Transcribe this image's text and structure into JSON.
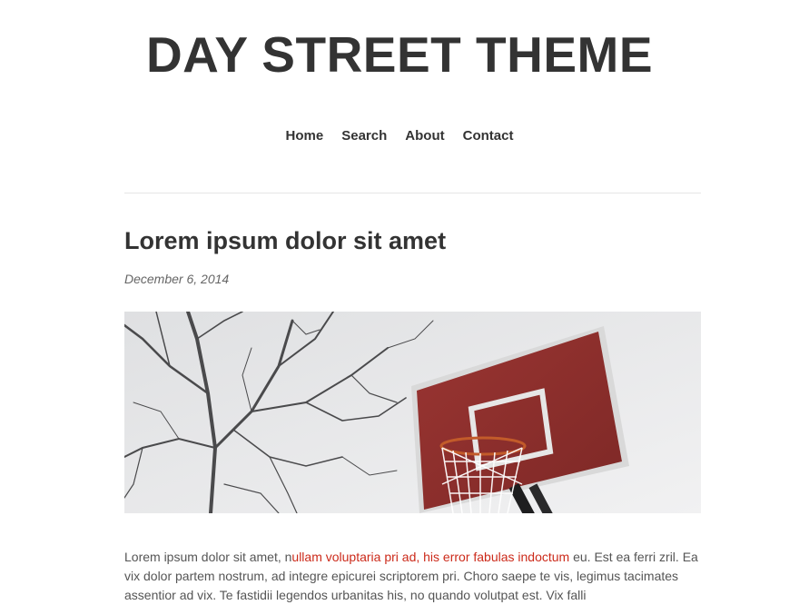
{
  "site": {
    "title": "DAY STREET THEME"
  },
  "nav": {
    "items": [
      {
        "label": "Home"
      },
      {
        "label": "Search"
      },
      {
        "label": "About"
      },
      {
        "label": "Contact"
      }
    ]
  },
  "post": {
    "title": "Lorem ipsum dolor sit amet",
    "date": "December 6, 2014",
    "image": {
      "subject": "basketball-hoop-photo"
    },
    "body_start": "Lorem ipsum dolor sit amet, n",
    "body_link": "ullam voluptaria pri ad, his error fabulas indoctum",
    "body_rest": " eu. Est ea ferri zril. Ea vix dolor partem nostrum, ad integre epicurei scriptorem pri. Choro saepe te vis, legimus tacimates assentior ad vix. Te fastidii legendos urbanitas his, no quando volutpat est. Vix falli"
  },
  "colors": {
    "link": "#cc2a1a",
    "text": "#333333",
    "backboard": "#8e2f2c"
  }
}
